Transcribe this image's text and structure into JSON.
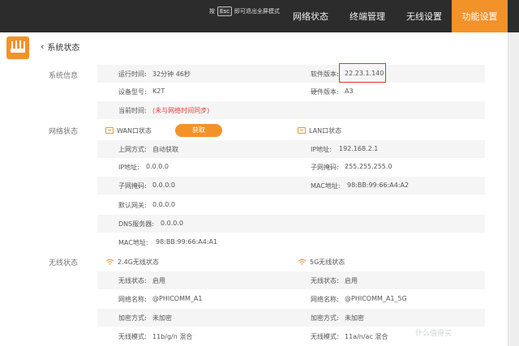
{
  "fullscreen_hint": {
    "press": "按",
    "key": "Esc",
    "text": "即可退出全屏模式"
  },
  "nav": {
    "items": [
      "网络状态",
      "终端管理",
      "无线设置",
      "功能设置"
    ],
    "active_index": 3
  },
  "breadcrumb": {
    "label": "系统状态"
  },
  "system_info": {
    "section_label": "系统信息",
    "uptime_label": "运行时间:",
    "uptime_value": "32分钟 46秒",
    "software_label": "软件版本:",
    "software_value": "22.23.1.140",
    "model_label": "设备型号:",
    "model_value": "K2T",
    "hardware_label": "硬件版本:",
    "hardware_value": "A3",
    "time_label": "当前时间:",
    "time_value": "(未与网络时间同步)"
  },
  "network_status": {
    "section_label": "网络状态",
    "wan": {
      "title": "WAN口状态",
      "button": "获取",
      "mode_label": "上网方式:",
      "mode_value": "自动获取",
      "ip_label": "IP地址:",
      "ip_value": "0.0.0.0",
      "mask_label": "子网掩码:",
      "mask_value": "0.0.0.0",
      "gateway_label": "默认网关:",
      "gateway_value": "0.0.0.0",
      "dns_label": "DNS服务器:",
      "dns_value": "0.0.0.0",
      "mac_label": "MAC地址:",
      "mac_value": "98:BB:99:66:A4:A1"
    },
    "lan": {
      "title": "LAN口状态",
      "ip_label": "IP地址:",
      "ip_value": "192.168.2.1",
      "mask_label": "子网掩码:",
      "mask_value": "255.255.255.0",
      "mac_label": "MAC地址:",
      "mac_value": "98:BB:99:66:A4:A2"
    }
  },
  "wireless_status": {
    "section_label": "无线状态",
    "band24": {
      "title": "2.4G无线状态",
      "status_label": "无线状态:",
      "status_value": "启用",
      "ssid_label": "网络名称:",
      "ssid_value": "@PHICOMM_A1",
      "enc_label": "加密方式:",
      "enc_value": "未加密",
      "mode_label": "无线模式:",
      "mode_value": "11b/g/n 混合"
    },
    "band5": {
      "title": "5G无线状态",
      "status_label": "无线状态:",
      "status_value": "启用",
      "ssid_label": "网络名称:",
      "ssid_value": "@PHICOMM_A1_5G",
      "enc_label": "加密方式:",
      "enc_value": "未加密",
      "mode_label": "无线模式:",
      "mode_value": "11a/n/ac 混合"
    }
  },
  "watermark": "什么值得买",
  "colors": {
    "accent": "#f4922a",
    "highlight": "#e03333",
    "topbar": "#2c2c2c"
  }
}
